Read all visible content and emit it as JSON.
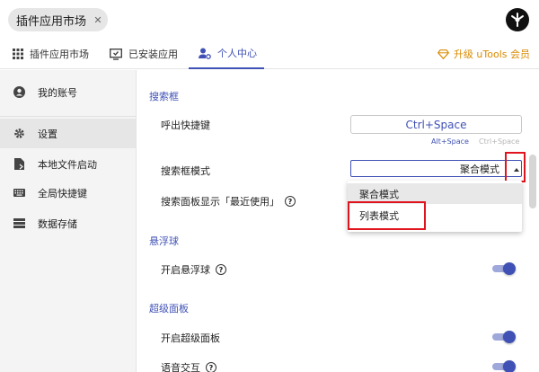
{
  "search": {
    "chip_label": "插件应用市场",
    "close_glyph": "✕"
  },
  "tabs": [
    {
      "label": "插件应用市场",
      "icon": "grid-icon"
    },
    {
      "label": "已安装应用",
      "icon": "installed-apps-icon"
    },
    {
      "label": "个人中心",
      "icon": "user-settings-icon",
      "active": true
    }
  ],
  "upgrade": {
    "label": "升级 uTools 会员",
    "icon": "diamond-icon"
  },
  "sidebar": {
    "items": [
      {
        "label": "我的账号",
        "icon": "account-icon"
      },
      {
        "label": "设置",
        "icon": "gear-icon",
        "active": true
      },
      {
        "label": "本地文件启动",
        "icon": "file-launch-icon"
      },
      {
        "label": "全局快捷键",
        "icon": "keyboard-icon"
      },
      {
        "label": "数据存储",
        "icon": "storage-icon"
      }
    ]
  },
  "main": {
    "search_section": {
      "title": "搜索框",
      "hotkey_label": "呼出快捷键",
      "hotkey_value": "Ctrl+Space",
      "hint_current": "Alt+Space",
      "hint_alt": "Ctrl+Space",
      "mode_label": "搜索框模式",
      "mode_value": "聚合模式",
      "mode_options": [
        "聚合模式",
        "列表模式"
      ],
      "recent_label": "搜索面板显示「最近使用」"
    },
    "float_section": {
      "title": "悬浮球",
      "enable_label": "开启悬浮球",
      "enabled": true
    },
    "super_section": {
      "title": "超级面板",
      "enable_label": "开启超级面板",
      "enabled": true,
      "voice_label": "语音交互",
      "voice_enabled": true
    },
    "help_glyph": "?"
  },
  "colors": {
    "accent": "#3f51b5",
    "highlight": "#e0141e",
    "upgrade": "#d98a00"
  }
}
